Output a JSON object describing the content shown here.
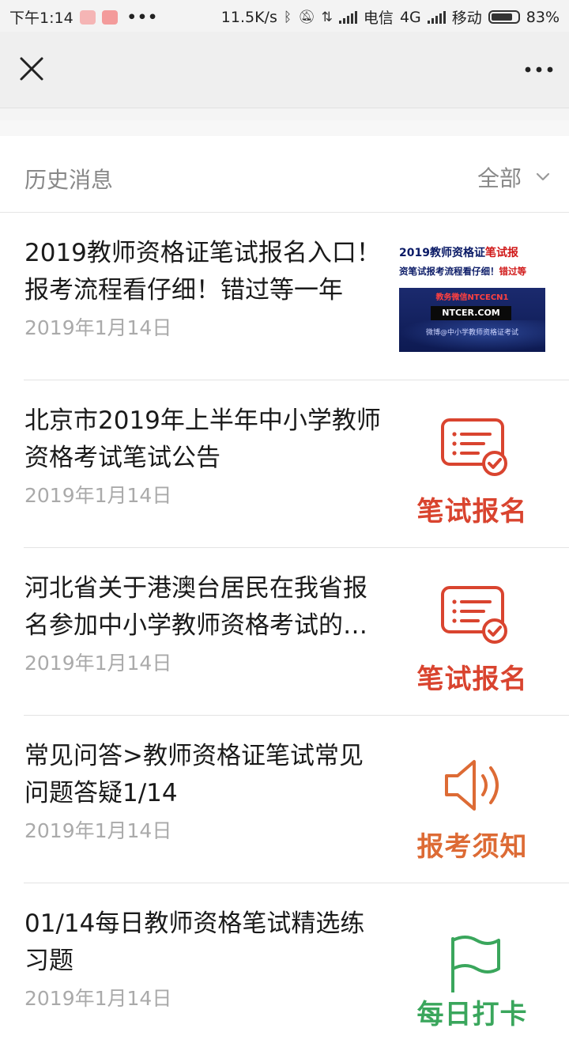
{
  "status_bar": {
    "time": "下午1:14",
    "speed": "11.5K/s",
    "carrier1": "电信",
    "network": "4G",
    "carrier2": "移动",
    "battery": "83%",
    "battery_level": 0.83,
    "icons": [
      "app-notification-icon",
      "app-notification-icon",
      "more-notifications-icon",
      "bluetooth-icon",
      "mute-icon",
      "data-transfer-icon",
      "signal-icon",
      "signal-icon",
      "battery-icon"
    ]
  },
  "navbar": {
    "close_icon": "close-icon",
    "more_icon": "more-icon"
  },
  "history": {
    "title": "历史消息",
    "filter_label": "全部",
    "filter_icon": "chevron-down-icon"
  },
  "articles": [
    {
      "title": "2019教师资格证笔试报名入口！报考流程看仔细！错过等一年",
      "date": "2019年1月14日",
      "thumb": {
        "type": "banner",
        "line1_prefix": "2019教师资格证",
        "line1_highlight": "笔试报",
        "line2_prefix": "资笔试报考流程看仔细！",
        "line2_highlight": "错过等",
        "line3": "教务微信NTCECN1",
        "domain": "NTCER.COM",
        "line4": "微博@中小学教师资格证考试"
      }
    },
    {
      "title": "北京市2019年上半年中小学教师资格考试笔试公告",
      "date": "2019年1月14日",
      "thumb": {
        "type": "icon",
        "icon": "registration-form-icon",
        "label": "笔试报名",
        "color": "#d9442f"
      }
    },
    {
      "title": "河北省关于港澳台居民在我省报名参加中小学教师资格考试的通知",
      "date": "2019年1月14日",
      "thumb": {
        "type": "icon",
        "icon": "registration-form-icon",
        "label": "笔试报名",
        "color": "#d9442f"
      }
    },
    {
      "title": "常见问答>教师资格证笔试常见问题答疑1/14",
      "date": "2019年1月14日",
      "thumb": {
        "type": "icon",
        "icon": "speaker-icon",
        "label": "报考须知",
        "color": "#dd6b35"
      }
    },
    {
      "title": "01/14每日教师资格笔试精选练习题",
      "date": "2019年1月14日",
      "thumb": {
        "type": "icon",
        "icon": "flag-icon",
        "label": "每日打卡",
        "color": "#3aa65c"
      }
    }
  ]
}
